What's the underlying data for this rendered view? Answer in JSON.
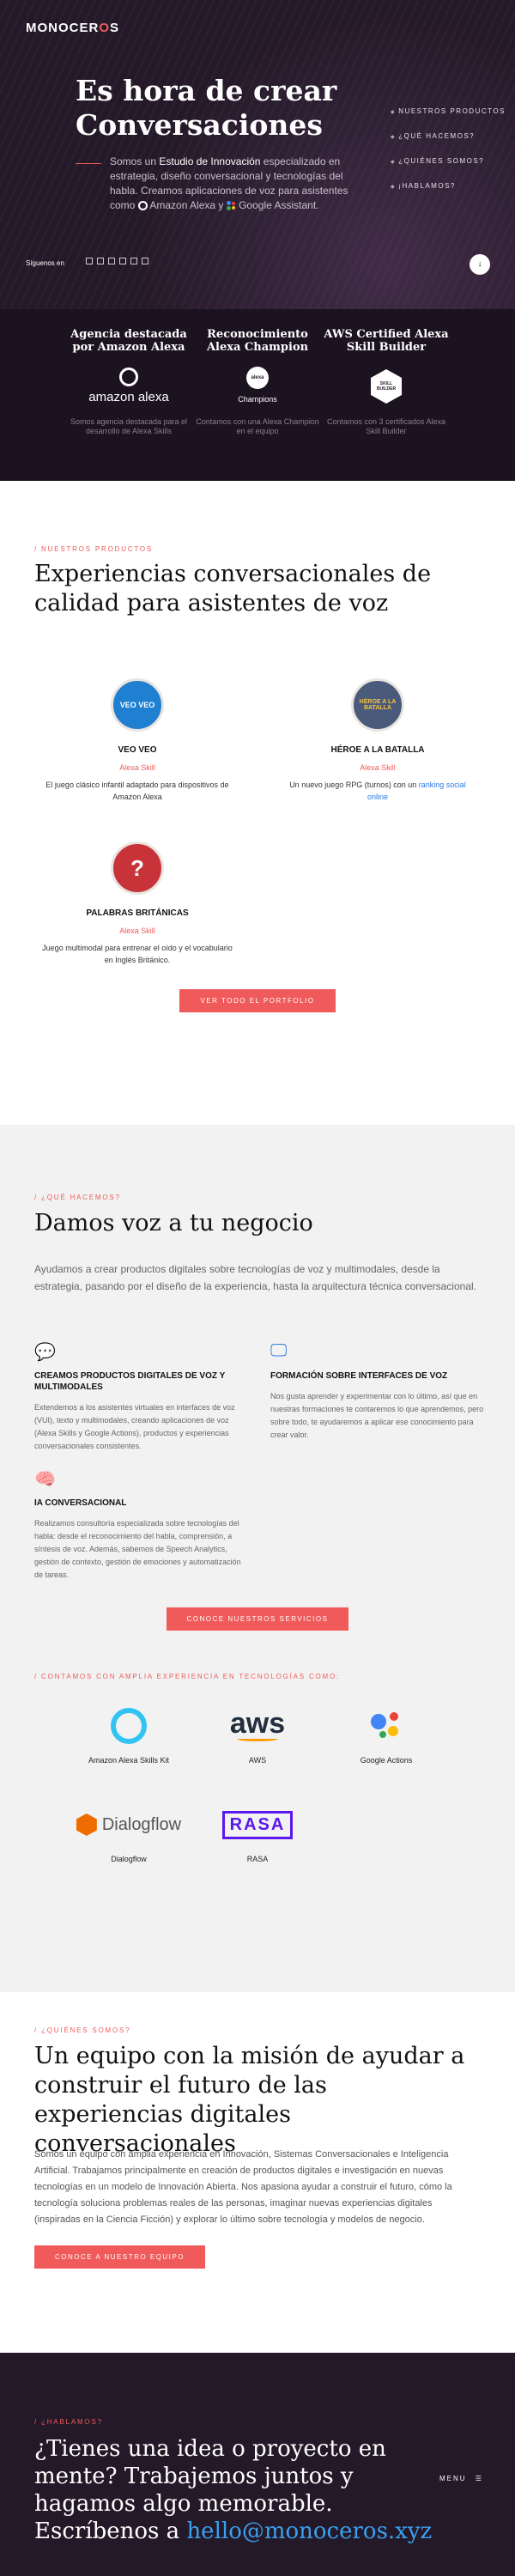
{
  "brand": {
    "logo_pre": "MONOCER",
    "logo_dot": "O",
    "logo_post": "S"
  },
  "hero": {
    "title": "Es hora de crear Conversaciones",
    "text_pre": "Somos un ",
    "text_bold": "Estudio de Innovación",
    "text_post": " especializado en estrategia, diseño conversacional y tecnologías del habla. Creamos aplicaciones de voz para asistentes como ",
    "alexa": "Amazon Alexa",
    "text_and": " y ",
    "google": "Google Assistant.",
    "nav": [
      "NUESTROS PRODUCTOS",
      "¿QUÉ HACEMOS?",
      "¿QUIÉNES SOMOS?",
      "¡HABLAMOS?"
    ],
    "follow_label": "Síguenos en",
    "down_icon": "↓"
  },
  "awards": [
    {
      "title": "Agencia destacada por Amazon Alexa",
      "logo_text": "amazon alexa",
      "desc": "Somos agencia destacada para el desarrollo de Alexa Skills"
    },
    {
      "title": "Reconocimiento Alexa Champion",
      "logo_text": "Champions",
      "logo_small": "alexa",
      "desc": "Contamos con una Alexa Champion en el equipo"
    },
    {
      "title": "AWS Certified Alexa Skill Builder",
      "logo_text": "SKILL BUILDER",
      "desc": "Contamos con 3 certificados Alexa Skill Builder"
    }
  ],
  "products": {
    "eyebrow": "/ NUESTROS PRODUCTOS",
    "title": "Experiencias conversacionales de calidad para asistentes de voz",
    "items": [
      {
        "badge": "VEO VEO",
        "name": "VEO VEO",
        "tag": "Alexa Skill",
        "desc": "El juego clásico infantil adaptado para dispositivos de Amazon Alexa",
        "color": "#1f7fd1"
      },
      {
        "badge": "HÉROE A LA BATALLA",
        "name": "HÉROE A LA BATALLA",
        "tag": "Alexa Skill",
        "desc_pre": "Un nuevo juego RPG (turnos) con un ",
        "desc_link": "ranking social online",
        "color": "#4a5a7a"
      },
      {
        "badge": "?",
        "name": "PALABRAS BRITÁNICAS",
        "tag": "Alexa Skill",
        "desc": "Juego multimodal para entrenar el oído y el vocabulario en Inglés Británico.",
        "color": "#c8333a"
      }
    ],
    "button": "VER TODO EL PORTFOLIO"
  },
  "services": {
    "eyebrow": "/ ¿QUÉ HACEMOS?",
    "title": "Damos voz a tu negocio",
    "intro": "Ayudamos a crear productos digitales sobre tecnologías de voz y multimodales, desde la estrategia, pasando por el diseño de la experiencia, hasta la arquitectura técnica conversacional.",
    "items": [
      {
        "icon": "chat-icon",
        "glyph": "💬",
        "title": "CREAMOS PRODUCTOS DIGITALES DE VOZ Y MULTIMODALES",
        "desc": "Extendemos a los asistentes virtuales en interfaces de voz (VUI), texto y multimodales, creando aplicaciones de voz (Alexa Skills y Google Actions), productos y experiencias conversacionales consistentes."
      },
      {
        "icon": "presentation-icon",
        "glyph": "🖵",
        "title": "FORMACIÓN SOBRE INTERFACES DE VOZ",
        "desc": "Nos gusta aprender y experimentar con lo último, así que en nuestras formaciones te contaremos lo que aprendemos, pero sobre todo, te ayudaremos a aplicar ese conocimiento para crear valor."
      },
      {
        "icon": "brain-icon",
        "glyph": "🧠",
        "title": "IA CONVERSACIONAL",
        "desc": "Realizamos consultoría especializada sobre tecnologías del habla: desde el reconocimiento del habla, comprensión, a síntesis de voz. Además, sabemos de Speech Analytics, gestión de contexto, gestión de emociones y automatización de tareas."
      }
    ],
    "button": "CONOCE NUESTROS SERVICIOS",
    "tech_eyebrow": "/ CONTAMOS CON AMPLIA EXPERIENCIA EN TECNOLOGÍAS COMO:",
    "tech": [
      {
        "name": "Amazon Alexa Skills Kit",
        "logo": "alexa-logo"
      },
      {
        "name": "AWS",
        "logo": "aws-logo",
        "logo_text": "aws"
      },
      {
        "name": "Google Actions",
        "logo": "google-assistant-logo"
      },
      {
        "name": "Dialogflow",
        "logo": "dialogflow-logo",
        "logo_text": "Dialogflow"
      },
      {
        "name": "RASA",
        "logo": "rasa-logo",
        "logo_text": "RASA"
      }
    ]
  },
  "team": {
    "eyebrow": "/ ¿QUIÉNES SOMOS?",
    "title": "Un equipo con la misión de ayudar a construir el futuro de las experiencias digitales conversacionales",
    "text": "Somos un equipo con amplia experiencia en Innovación, Sistemas Conversacionales e Inteligencia Artificial. Trabajamos principalmente en creación de productos digitales e investigación en nuevas tecnologías en un modelo de Innovación Abierta. Nos apasiona ayudar a construir el futuro, cómo la tecnología soluciona problemas reales de las personas, imaginar nuevas experiencias digitales (inspiradas en la Ciencia Ficción) y explorar lo último sobre tecnología y modelos de negocio.",
    "button": "CONOCE A NUESTRO EQUIPO"
  },
  "contact": {
    "eyebrow": "/ ¿HABLAMOS?",
    "title": "¿Tienes una idea o proyecto en mente? Trabajemos juntos y hagamos algo memorable. Escríbenos a",
    "email": "hello@monoceros.xyz",
    "menu_label": "MENU"
  }
}
